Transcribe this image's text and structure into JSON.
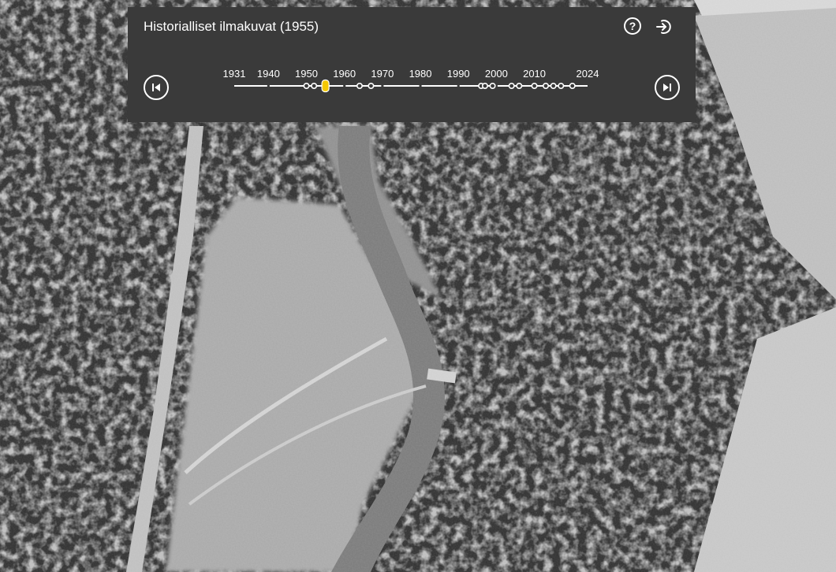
{
  "panel": {
    "title": "Historialliset ilmakuvat (1955)",
    "help_icon": "question-circle-icon",
    "exit_icon": "exit-arrow-icon",
    "prev_icon": "skip-previous-icon",
    "next_icon": "skip-next-icon",
    "help_glyph": "?"
  },
  "timeline": {
    "year_min": 1931,
    "year_max": 2024,
    "tick_labels": [
      "1931",
      "1940",
      "1950",
      "1960",
      "1970",
      "1980",
      "1990",
      "2000",
      "2010",
      "2024"
    ],
    "tick_years": [
      1931,
      1940,
      1950,
      1960,
      1970,
      1980,
      1990,
      2000,
      2010,
      2024
    ],
    "available_years": [
      1950,
      1952,
      1964,
      1967,
      1996,
      1997,
      1999,
      2004,
      2006,
      2010,
      2013,
      2015,
      2017,
      2020
    ],
    "selected_year": 1955
  },
  "colors": {
    "panel_bg": "#3a3a3a",
    "selected_marker": "#f5c800",
    "line": "#ffffff"
  }
}
